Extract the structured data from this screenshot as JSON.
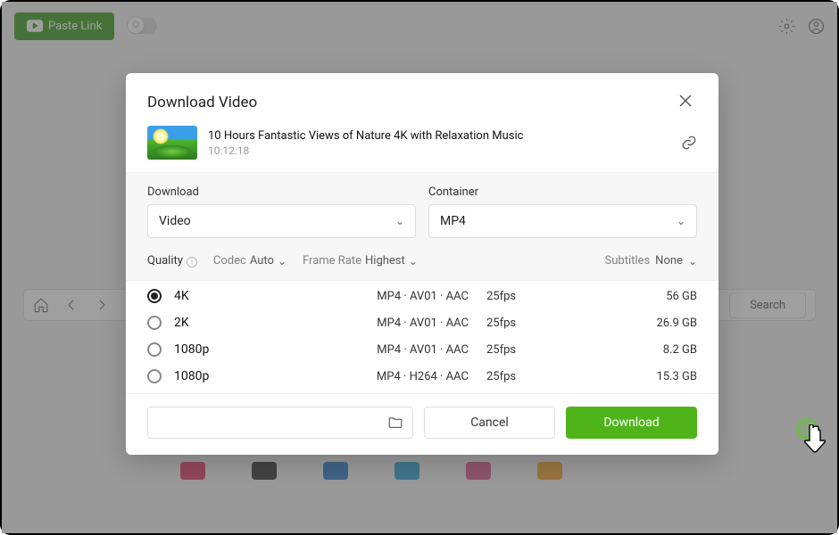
{
  "topbar": {
    "paste_label": "Paste Link"
  },
  "browser": {
    "search_label": "Search"
  },
  "modal": {
    "title": "Download Video",
    "video_title": "10 Hours Fantastic Views of Nature 4K with Relaxation Music",
    "video_duration": "10:12:18",
    "download_label": "Download",
    "download_value": "Video",
    "container_label": "Container",
    "container_value": "MP4",
    "quality_label": "Quality",
    "codec_label": "Codec",
    "codec_value": "Auto",
    "framerate_label": "Frame Rate",
    "framerate_value": "Highest",
    "subtitles_label": "Subtitles",
    "subtitles_value": "None",
    "cancel_label": "Cancel",
    "download_btn_label": "Download",
    "rows": [
      {
        "label": "4K",
        "codec": "MP4 · AV01 · AAC",
        "fps": "25fps",
        "size": "56 GB",
        "selected": true
      },
      {
        "label": "2K",
        "codec": "MP4 · AV01 · AAC",
        "fps": "25fps",
        "size": "26.9 GB",
        "selected": false
      },
      {
        "label": "1080p",
        "codec": "MP4 · AV01 · AAC",
        "fps": "25fps",
        "size": "8.2 GB",
        "selected": false
      },
      {
        "label": "1080p",
        "codec": "MP4 · H264 · AAC",
        "fps": "25fps",
        "size": "15.3 GB",
        "selected": false
      }
    ]
  },
  "site_colors": [
    "#e23b6e",
    "#333333",
    "#2e7acb",
    "#2ea2d6",
    "#d85a8a",
    "#f0a030"
  ]
}
